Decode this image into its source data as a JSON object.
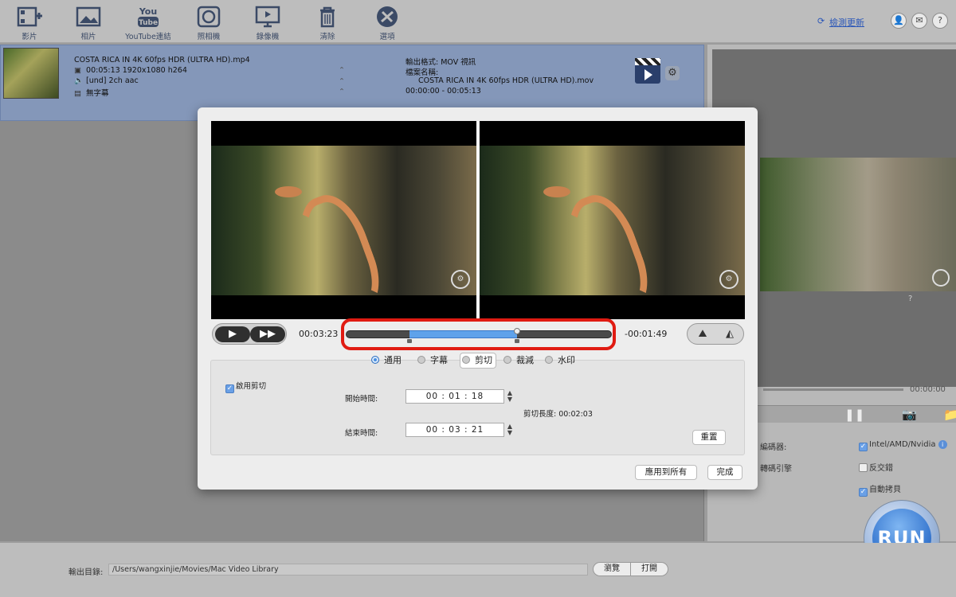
{
  "toolbar": {
    "items": [
      {
        "label": "影片"
      },
      {
        "label": "相片"
      },
      {
        "label": "YouTube連結"
      },
      {
        "label": "照相機"
      },
      {
        "label": "錄像機"
      },
      {
        "label": "清除"
      },
      {
        "label": "選項"
      }
    ],
    "youtube_icon_text_top": "You",
    "youtube_icon_text_bottom": "Tube",
    "update_link": "檢測更新"
  },
  "file": {
    "name": "COSTA RICA IN 4K 60fps HDR (ULTRA HD).mp4",
    "video_info": "00:05:13 1920x1080 h264",
    "audio_info": "[und] 2ch aac",
    "subtitle_info": "無字幕",
    "output_format": "輸出格式: MOV 視訊",
    "output_name_label": "檔案名稱:",
    "output_name": "COSTA RICA IN 4K 60fps HDR (ULTRA HD).mov",
    "output_range": "00:00:00 - 00:05:13"
  },
  "preview": {
    "time": "00:00:00",
    "help_glyph": "?"
  },
  "options": {
    "encoder_label": "編碼器:",
    "engine_label": "轉碼引擎",
    "hw_accel": "Intel/AMD/Nvidia",
    "deinterlace": "反交錯",
    "auto_copy": "自動拷貝"
  },
  "run_label": "RUN",
  "bottom": {
    "output_dir_label": "輸出目錄:",
    "output_dir": "/Users/wangxinjie/Movies/Mac Video Library",
    "browse": "瀏覽",
    "open": "打開"
  },
  "editor": {
    "current_time": "00:03:23",
    "remaining_time": "-00:01:49",
    "tabs": [
      {
        "label": "通用",
        "active": false
      },
      {
        "label": "字幕",
        "active": false
      },
      {
        "label": "剪切",
        "active": true
      },
      {
        "label": "裁減",
        "active": false
      },
      {
        "label": "水印",
        "active": false
      }
    ],
    "enable_trim_label": "啟用剪切",
    "enable_trim_checked": true,
    "start_label": "開始時間:",
    "start_time": "00 : 01 : 18",
    "end_label": "結束時間:",
    "end_time": "00 : 03 : 21",
    "length_label": "剪切長度: 00:02:03",
    "reset": "重置",
    "apply_all": "應用到所有",
    "done": "完成",
    "selection_start_fraction": 0.24,
    "selection_end_fraction": 0.645
  },
  "colors": {
    "accent": "#4a8fe2",
    "highlight": "#e01b12",
    "file_row": "#8497b9"
  }
}
